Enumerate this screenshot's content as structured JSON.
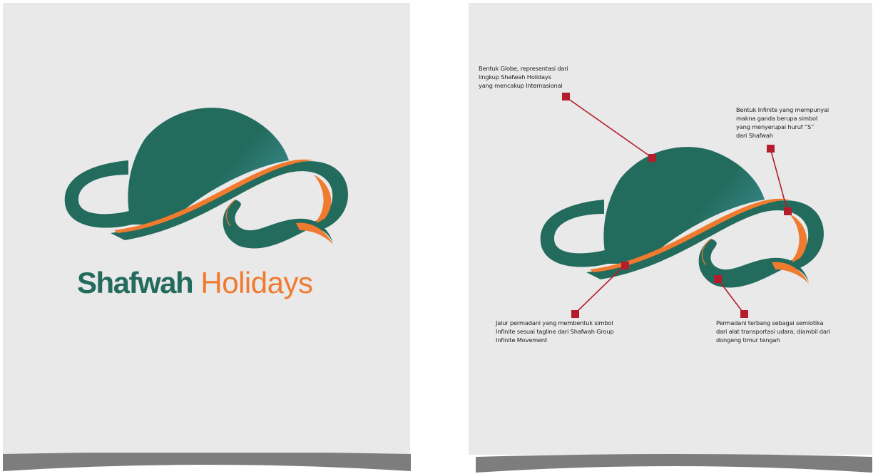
{
  "logo": {
    "brand_word": "Shafwah",
    "second_word": "Holidays"
  },
  "colors": {
    "background": "#e9e9e9",
    "globe_teal": "#236b5d",
    "accent_orange": "#f07a2d",
    "marker_red": "#b51d2c",
    "curl_gray": "#7d7d7d"
  },
  "annotations": {
    "globe": "Bentuk Globe,  representasi   dari\nlingkup Shafwah Holidays\nyang mencakup Internasional",
    "infinite": "Bentuk Infinite yang mempunyai\nmakna ganda berupa simbol\nyang menyerupai huruf “S”\ndari Shafwah",
    "carpet": "Jalur permadani yang membentuk simbol\nInfinite sesuai tagline dari Shafwah Group\nInfinite Movement",
    "flying_carpet": "Permadani terbang sebagai semiotika\ndari alat transportasi  udara,  diambil  dari\ndongeng timur tengah"
  }
}
